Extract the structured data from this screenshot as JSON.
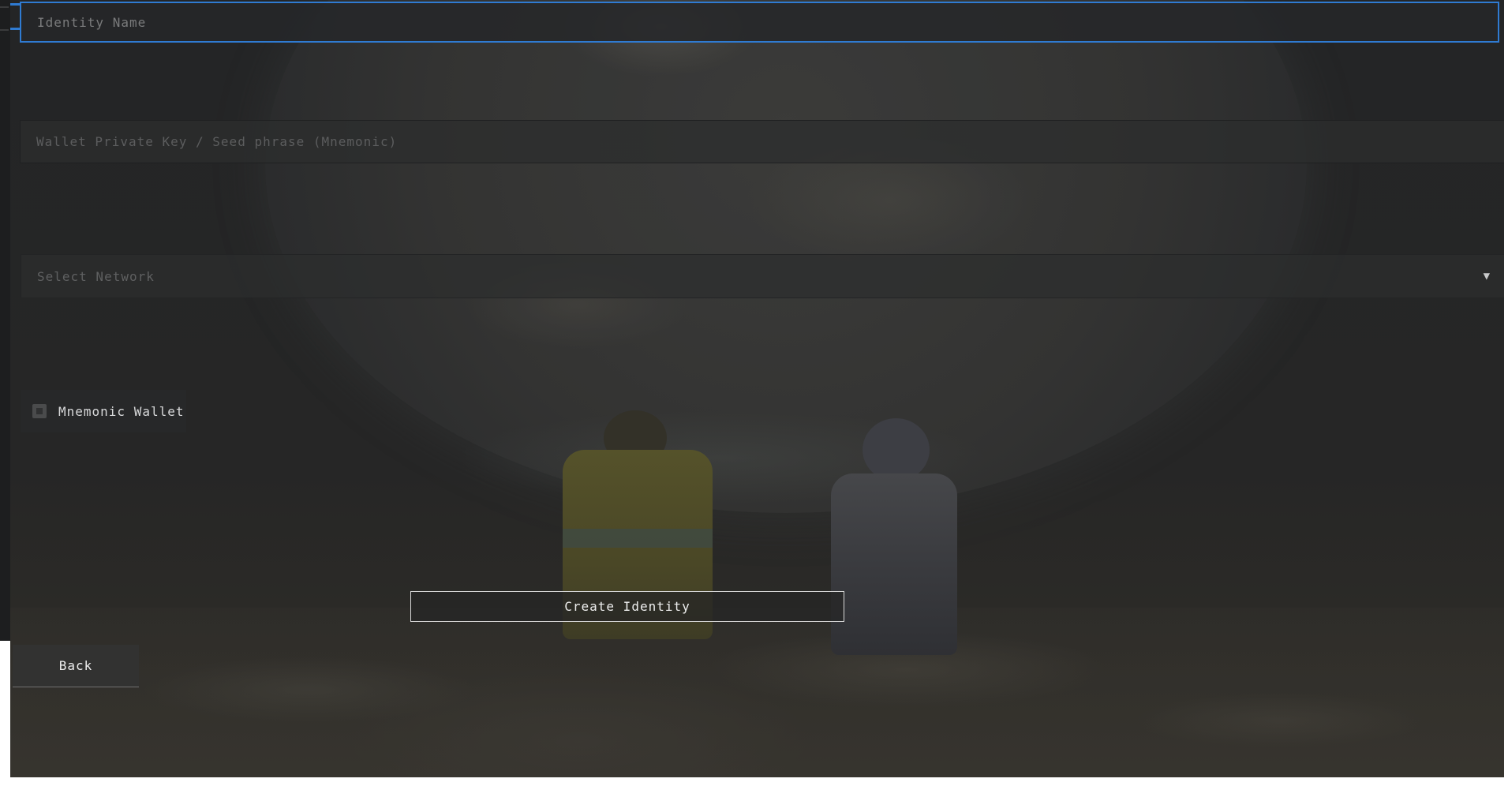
{
  "form": {
    "identity_name_placeholder": "Identity Name",
    "identity_name_value": "",
    "wallet_key_placeholder": "Wallet Private Key / Seed phrase (Mnemonic)",
    "wallet_key_value": "",
    "network_select_label": "Select Network",
    "network_select_arrow": "▼",
    "mnemonic_wallet_label": "Mnemonic Wallet",
    "mnemonic_wallet_checked": false,
    "create_identity_label": "Create Identity",
    "back_label": "Back"
  },
  "colors": {
    "focus_accent": "#2f7bd2",
    "background": "#262728",
    "text_primary": "#eeeeee",
    "text_placeholder": "#7a7b7c"
  },
  "icons": {
    "network_select_arrow": "chevron-down-icon",
    "mnemonic_checkbox": "checkbox-icon"
  }
}
